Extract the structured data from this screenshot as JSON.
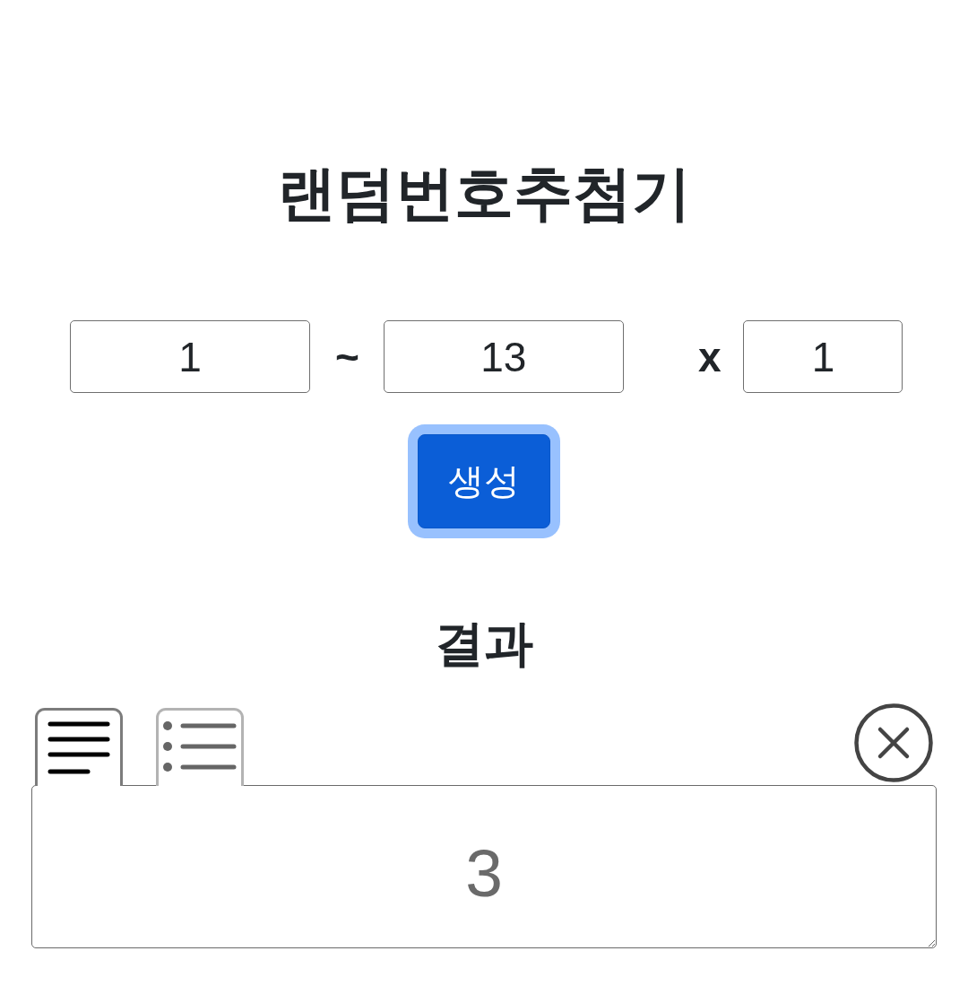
{
  "title": "랜덤번호추첨기",
  "range": {
    "from": {
      "value": "1"
    },
    "separator": "~",
    "to": {
      "value": "13"
    },
    "times_label": "x",
    "count": {
      "value": "1"
    }
  },
  "generate_button": {
    "label": "생성",
    "focused": true
  },
  "result": {
    "heading": "결과",
    "view_tabs": [
      {
        "kind": "text",
        "selected": true
      },
      {
        "kind": "list",
        "selected": false
      }
    ],
    "output": "3"
  }
}
